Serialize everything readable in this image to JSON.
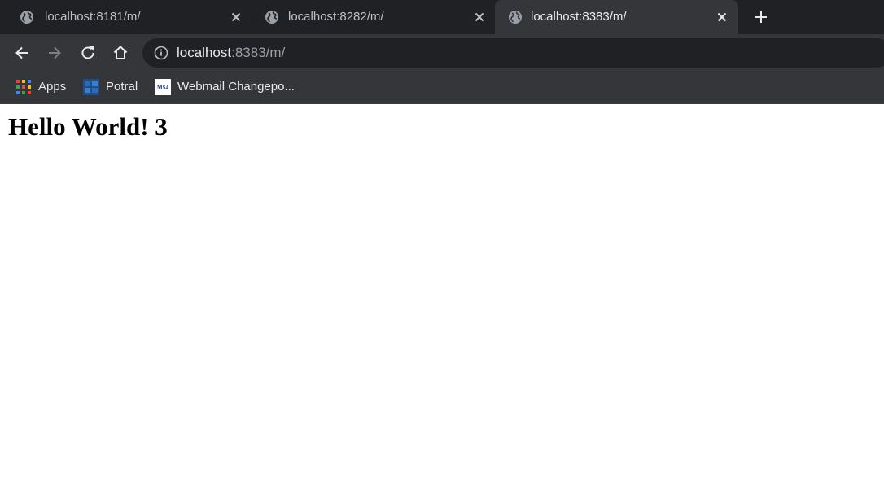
{
  "tabs": [
    {
      "title": "localhost:8181/m/",
      "active": false
    },
    {
      "title": "localhost:8282/m/",
      "active": false
    },
    {
      "title": "localhost:8383/m/",
      "active": true
    }
  ],
  "toolbar": {
    "url_host": "localhost",
    "url_rest": ":8383/m/"
  },
  "bookmarks": [
    {
      "label": "Apps",
      "icon": "apps-grid-icon"
    },
    {
      "label": "Potral",
      "icon": "potral-favicon"
    },
    {
      "label": "Webmail Changepo...",
      "icon": "webmail-favicon",
      "icon_text": "MS4"
    }
  ],
  "page": {
    "heading": "Hello World! 3"
  },
  "colors": {
    "tabstrip_bg": "#202124",
    "toolbar_bg": "#35363a",
    "omnibox_bg": "#202124",
    "page_bg": "#ffffff"
  }
}
